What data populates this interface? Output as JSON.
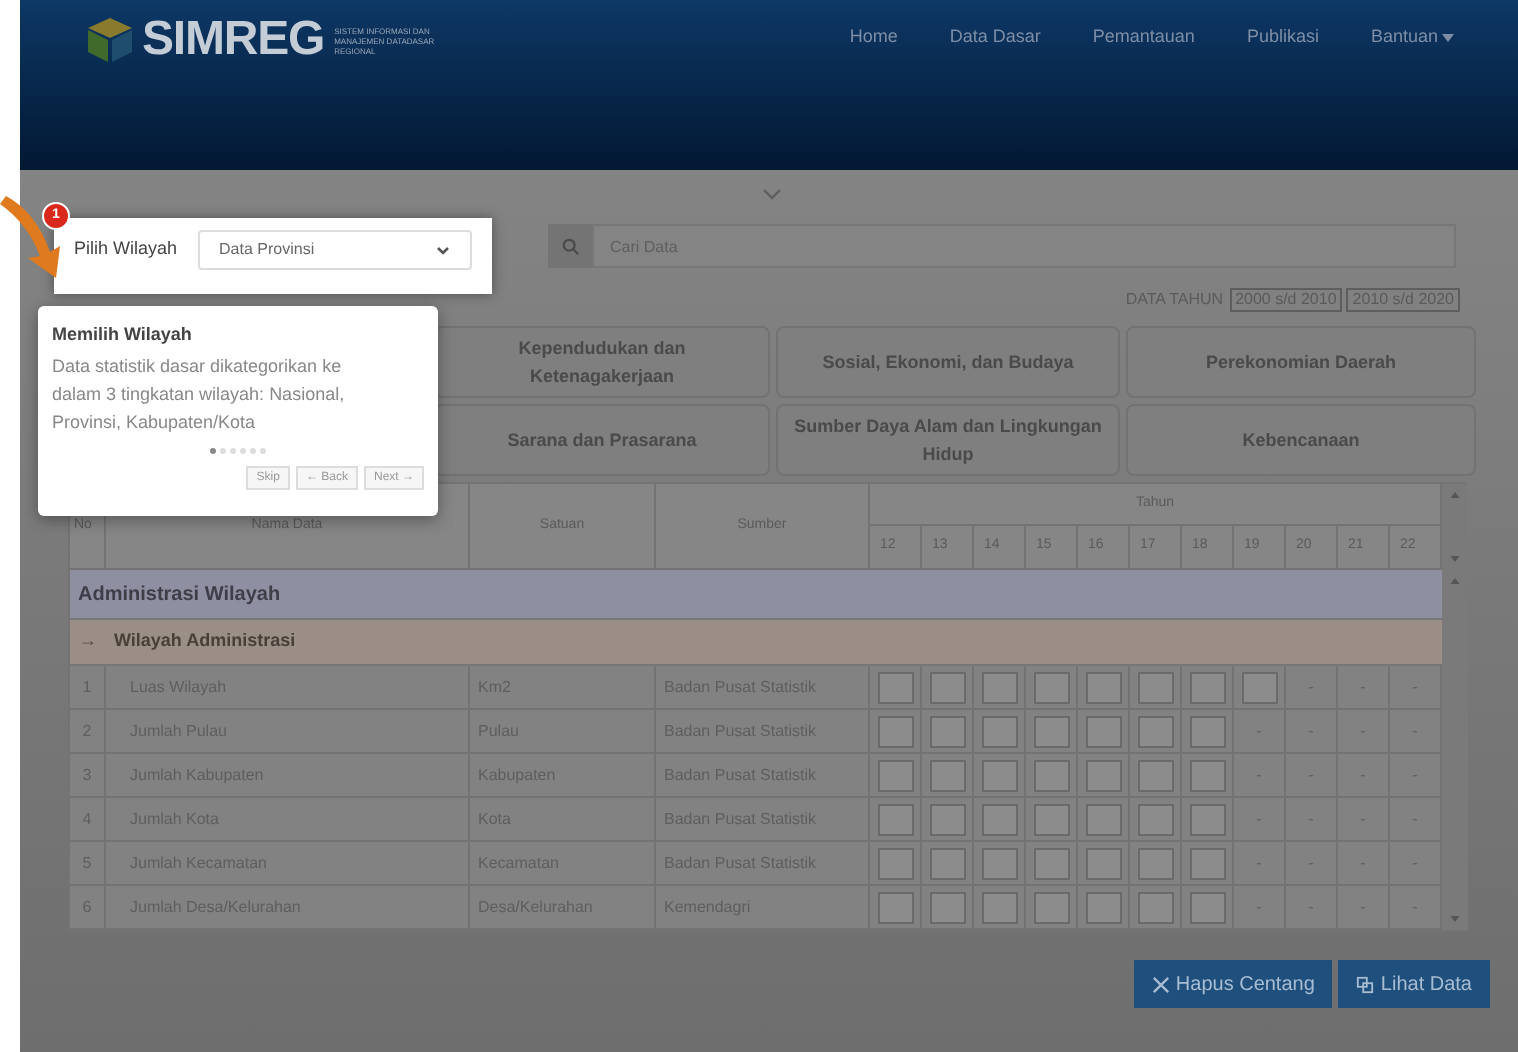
{
  "header": {
    "logo_text": "SIMREG",
    "logo_subtitle": [
      "SISTEM INFORMASI DAN",
      "MANAJEMEN DATADASAR",
      "REGIONAL"
    ],
    "nav": [
      {
        "label": "Home",
        "has_menu": false
      },
      {
        "label": "Data Dasar",
        "has_menu": false
      },
      {
        "label": "Pemantauan",
        "has_menu": false
      },
      {
        "label": "Publikasi",
        "has_menu": false
      },
      {
        "label": "Bantuan",
        "has_menu": true
      }
    ]
  },
  "filter": {
    "label": "Pilih Wilayah",
    "value": "Data Provinsi",
    "search_placeholder": "Cari Data"
  },
  "year_range": {
    "label": "DATA TAHUN",
    "options": [
      "2000 s/d 2010",
      "2010 s/d 2020"
    ]
  },
  "categories": [
    "Kependudukan dan Ketenagakerjaan",
    "Sosial, Ekonomi, dan Budaya",
    "Perekonomian Daerah",
    "Sarana dan Prasarana",
    "Sumber Daya Alam dan Lingkungan Hidup",
    "Kebencanaan"
  ],
  "table": {
    "columns": {
      "no": "No",
      "name": "Nama Data",
      "unit": "Satuan",
      "source": "Sumber",
      "years_label": "Tahun",
      "years": [
        "12",
        "13",
        "14",
        "15",
        "16",
        "17",
        "18",
        "19",
        "20",
        "21",
        "22"
      ]
    },
    "groups": [
      {
        "title": "Administrasi Wilayah",
        "subgroups": [
          {
            "arrow": "→",
            "title": "Wilayah Administrasi",
            "rows": [
              {
                "no": "1",
                "name": "Luas Wilayah",
                "unit": "Km2",
                "source": "Badan Pusat Statistik",
                "cells": [
                  {
                    "kind": "checkbox",
                    "checked": false
                  },
                  {
                    "kind": "checkbox",
                    "checked": false
                  },
                  {
                    "kind": "checkbox",
                    "checked": false
                  },
                  {
                    "kind": "checkbox",
                    "checked": false
                  },
                  {
                    "kind": "checkbox",
                    "checked": false
                  },
                  {
                    "kind": "checkbox",
                    "checked": false
                  },
                  {
                    "kind": "checkbox",
                    "checked": false
                  },
                  {
                    "kind": "checkbox",
                    "checked": false
                  },
                  {
                    "kind": "dash",
                    "text": "-"
                  },
                  {
                    "kind": "dash",
                    "text": "-"
                  },
                  {
                    "kind": "dash",
                    "text": "-"
                  }
                ]
              },
              {
                "no": "2",
                "name": "Jumlah Pulau",
                "unit": "Pulau",
                "source": "Badan Pusat Statistik",
                "cells": [
                  {
                    "kind": "checkbox",
                    "checked": false
                  },
                  {
                    "kind": "checkbox",
                    "checked": false
                  },
                  {
                    "kind": "checkbox",
                    "checked": false
                  },
                  {
                    "kind": "checkbox",
                    "checked": false
                  },
                  {
                    "kind": "checkbox",
                    "checked": false
                  },
                  {
                    "kind": "checkbox",
                    "checked": false
                  },
                  {
                    "kind": "checkbox",
                    "checked": false
                  },
                  {
                    "kind": "dash",
                    "text": "-"
                  },
                  {
                    "kind": "dash",
                    "text": "-"
                  },
                  {
                    "kind": "dash",
                    "text": "-"
                  },
                  {
                    "kind": "dash",
                    "text": "-"
                  }
                ]
              },
              {
                "no": "3",
                "name": "Jumlah Kabupaten",
                "unit": "Kabupaten",
                "source": "Badan Pusat Statistik",
                "cells": [
                  {
                    "kind": "checkbox",
                    "checked": false
                  },
                  {
                    "kind": "checkbox",
                    "checked": false
                  },
                  {
                    "kind": "checkbox",
                    "checked": false
                  },
                  {
                    "kind": "checkbox",
                    "checked": false
                  },
                  {
                    "kind": "checkbox",
                    "checked": false
                  },
                  {
                    "kind": "checkbox",
                    "checked": false
                  },
                  {
                    "kind": "checkbox",
                    "checked": false
                  },
                  {
                    "kind": "dash",
                    "text": "-"
                  },
                  {
                    "kind": "dash",
                    "text": "-"
                  },
                  {
                    "kind": "dash",
                    "text": "-"
                  },
                  {
                    "kind": "dash",
                    "text": "-"
                  }
                ]
              },
              {
                "no": "4",
                "name": "Jumlah Kota",
                "unit": "Kota",
                "source": "Badan Pusat Statistik",
                "cells": [
                  {
                    "kind": "checkbox",
                    "checked": false
                  },
                  {
                    "kind": "checkbox",
                    "checked": false
                  },
                  {
                    "kind": "checkbox",
                    "checked": false
                  },
                  {
                    "kind": "checkbox",
                    "checked": false
                  },
                  {
                    "kind": "checkbox",
                    "checked": false
                  },
                  {
                    "kind": "checkbox",
                    "checked": false
                  },
                  {
                    "kind": "checkbox",
                    "checked": false
                  },
                  {
                    "kind": "dash",
                    "text": "-"
                  },
                  {
                    "kind": "dash",
                    "text": "-"
                  },
                  {
                    "kind": "dash",
                    "text": "-"
                  },
                  {
                    "kind": "dash",
                    "text": "-"
                  }
                ]
              },
              {
                "no": "5",
                "name": "Jumlah Kecamatan",
                "unit": "Kecamatan",
                "source": "Badan Pusat Statistik",
                "cells": [
                  {
                    "kind": "checkbox",
                    "checked": false
                  },
                  {
                    "kind": "checkbox",
                    "checked": false
                  },
                  {
                    "kind": "checkbox",
                    "checked": false
                  },
                  {
                    "kind": "checkbox",
                    "checked": false
                  },
                  {
                    "kind": "checkbox",
                    "checked": false
                  },
                  {
                    "kind": "checkbox",
                    "checked": false
                  },
                  {
                    "kind": "checkbox",
                    "checked": false
                  },
                  {
                    "kind": "dash",
                    "text": "-"
                  },
                  {
                    "kind": "dash",
                    "text": "-"
                  },
                  {
                    "kind": "dash",
                    "text": "-"
                  },
                  {
                    "kind": "dash",
                    "text": "-"
                  }
                ]
              },
              {
                "no": "6",
                "name": "Jumlah Desa/Kelurahan",
                "unit": "Desa/Kelurahan",
                "source": "Kemendagri",
                "cells": [
                  {
                    "kind": "checkbox",
                    "checked": false
                  },
                  {
                    "kind": "checkbox",
                    "checked": false
                  },
                  {
                    "kind": "checkbox",
                    "checked": false
                  },
                  {
                    "kind": "checkbox",
                    "checked": false
                  },
                  {
                    "kind": "checkbox",
                    "checked": false
                  },
                  {
                    "kind": "checkbox",
                    "checked": false
                  },
                  {
                    "kind": "checkbox",
                    "checked": false
                  },
                  {
                    "kind": "dash",
                    "text": "-"
                  },
                  {
                    "kind": "dash",
                    "text": "-"
                  },
                  {
                    "kind": "dash",
                    "text": "-"
                  },
                  {
                    "kind": "dash",
                    "text": "-"
                  }
                ]
              }
            ]
          }
        ]
      }
    ]
  },
  "actions": [
    {
      "label": "Hapus Centang",
      "kind": "clear"
    },
    {
      "label": "Lihat Data",
      "kind": "view"
    }
  ],
  "tour": {
    "step": "1",
    "title": "Memilih Wilayah",
    "text": "Data statistik dasar dikategorikan ke dalam 3 tingkatan wilayah: Nasional, Provinsi, Kabupaten/Kota",
    "dots": [
      {
        "selected": true
      },
      {
        "selected": false
      },
      {
        "selected": false
      },
      {
        "selected": false
      },
      {
        "selected": false
      },
      {
        "selected": false
      }
    ],
    "buttons": [
      "Skip",
      "← Back",
      "Next →"
    ]
  }
}
